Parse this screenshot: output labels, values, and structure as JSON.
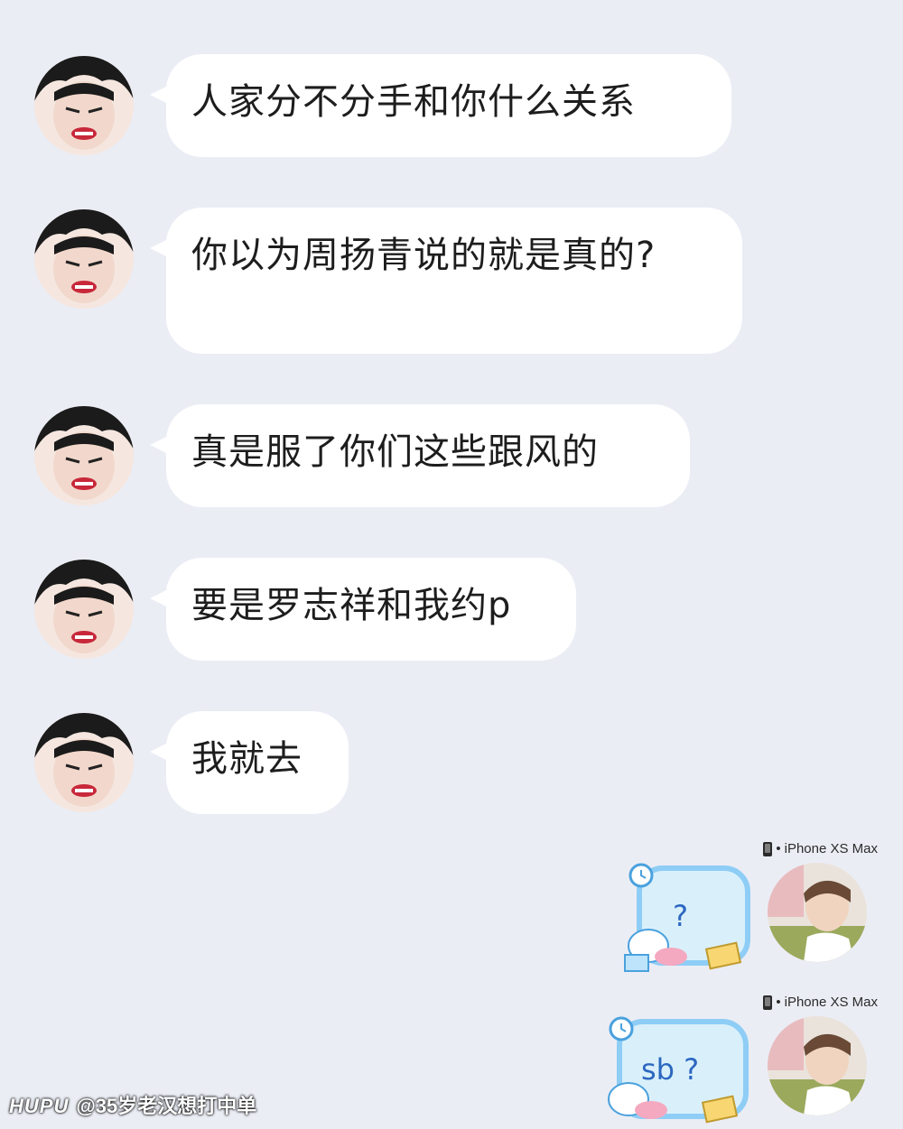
{
  "messages_in": [
    {
      "text": "人家分不分手和你什么关系"
    },
    {
      "text": "你以为周扬青说的就是真的?"
    },
    {
      "text": "真是服了你们这些跟风的"
    },
    {
      "text": "要是罗志祥和我约p"
    },
    {
      "text": "我就去"
    }
  ],
  "messages_out": [
    {
      "device": "iPhone XS Max",
      "sticker_text": "?"
    },
    {
      "device": "iPhone XS Max",
      "sticker_text": "sb ?"
    }
  ],
  "watermark": {
    "brand": "HUPU",
    "author": "@35岁老汉想打中单"
  },
  "colors": {
    "background": "#ebedf5",
    "bubble": "#ffffff",
    "sticker_blue": "#8ecdf5"
  }
}
